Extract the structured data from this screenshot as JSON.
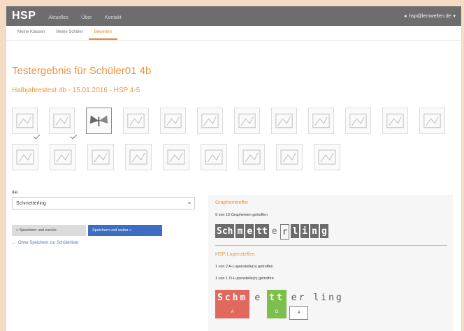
{
  "app": {
    "brand": "HSP"
  },
  "topnav": [
    "Aktuelles",
    "Über",
    "Kontakt"
  ],
  "user": {
    "email": "hsp@lernwelten.de"
  },
  "subnav": {
    "tabs": [
      "Meine Klassen",
      "Meine Schüler",
      "Bewerten"
    ]
  },
  "page": {
    "title": "Testergebnis für Schüler01 4b",
    "subtitle": "Halbjahrestest 4b - 15.01.2016 - HSP 4-5"
  },
  "word_field": {
    "label": "dat",
    "value": "Schmetterling",
    "placeholder": ""
  },
  "buttons": {
    "back": "« Speichern und zurück",
    "next": "Speichern und weiter »",
    "link": "Ohne Speichern zur Schülerliste"
  },
  "graphemes": {
    "heading": "Graphemtreffer",
    "summary": "9 von 10 Graphemen getroffen",
    "letters": [
      {
        "t": "Sch",
        "style": "dark"
      },
      {
        "t": "m",
        "style": "dark"
      },
      {
        "t": "e",
        "style": "dark"
      },
      {
        "t": "tt",
        "style": "dark"
      },
      {
        "t": "e",
        "style": "light"
      },
      {
        "t": "r",
        "style": "box"
      },
      {
        "t": "l",
        "style": "dark"
      },
      {
        "t": "i",
        "style": "dark"
      },
      {
        "t": "n",
        "style": "dark"
      },
      {
        "t": "g",
        "style": "dark"
      }
    ]
  },
  "strategies": {
    "heading": "HSP-Lupenstellen",
    "line1": "1 von 2 A-Lupenstelle(n) getroffen",
    "line2": "1 von 1 O-Lupenstelle(n) getroffen",
    "groups": [
      {
        "t": "Schm",
        "mark": "A",
        "style": "red"
      },
      {
        "t": "e",
        "mark": "",
        "style": "plain"
      },
      {
        "t": "tt",
        "mark": "O",
        "style": "green"
      },
      {
        "t": "er",
        "mark": "A",
        "style": "boxed"
      },
      {
        "t": "ling",
        "mark": "",
        "style": "plain"
      }
    ]
  },
  "thumbnails": {
    "row1": [
      "thumbnail-1",
      "thumbnail-2",
      "thumbnail-3",
      "thumbnail-4",
      "thumbnail-5",
      "thumbnail-6",
      "thumbnail-7",
      "thumbnail-8",
      "thumbnail-9",
      "thumbnail-10",
      "thumbnail-11",
      "thumbnail-12"
    ],
    "row2": [
      "thumbnail-13",
      "thumbnail-14",
      "thumbnail-15",
      "thumbnail-16",
      "thumbnail-17",
      "thumbnail-18",
      "thumbnail-19",
      "thumbnail-20",
      "thumbnail-21"
    ],
    "selected": "thumbnail-3"
  }
}
